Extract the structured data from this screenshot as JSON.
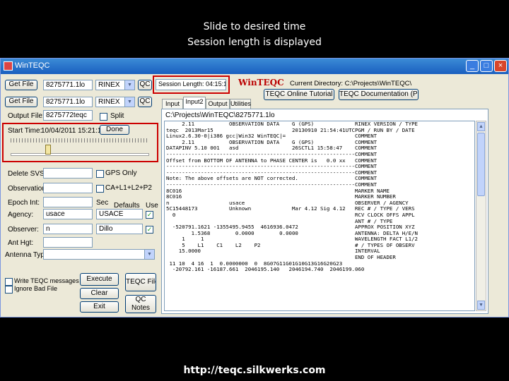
{
  "captions": {
    "line1": "Slide to desired time",
    "line2": "Session length is displayed",
    "url": "http://teqc.silkwerks.com"
  },
  "window": {
    "title": "WinTEQC",
    "controls": [
      "_",
      "□",
      "×"
    ]
  },
  "form": {
    "get_file_btn": "Get File",
    "get_file_path": "8275771.1lo",
    "get_file_combo": "RINEX",
    "qc_btn_1": "QC",
    "get_file2_btn": "Get File",
    "get_file2_path": "8275771.1lo",
    "get_file2_combo": "RINEX",
    "qc_btn_2": "QC",
    "output_file_label": "Output File:",
    "output_file_value": "8275772teqc",
    "split_label": "Split",
    "start_time_label": "Start Time:",
    "start_time_value": "10/04/2011 15:21:15",
    "done_btn": "Done",
    "delete_svs_label": "Delete SVS:",
    "gps_only_label": "GPS Only",
    "observations_label": "Observations:",
    "l1l2_label": "CA+L1+L2+P2",
    "epoch_int_label": "Epoch Int:",
    "sec_label": "Sec",
    "defaults_label": "Defaults",
    "use_label": "Use",
    "agency_label": "Agency:",
    "agency_value": "usace",
    "agency_default": "USACE",
    "observer_label": "Observer:",
    "observer_value": "n",
    "observer_default": "Dillo",
    "ant_hgt_label": "Ant Hgt:",
    "antenna_type_label": "Antenna Type",
    "write_teqc_label": "Write TEQC messages",
    "ignore_bad_label": "Ignore Bad File",
    "execute_btn": "Execute",
    "clear_btn": "Clear",
    "exit_btn": "Exit",
    "teqc_file_btn": "TEQC File",
    "qc_notes_btn": "QC Notes"
  },
  "header": {
    "session_length": "Session Length: 04:15:15",
    "logo": "WinTEQC",
    "current_dir": "Current Directory:  C:\\Projects\\WinTEQC\\",
    "online_tutorial_btn": "TEQC Online Tutorial",
    "documentation_btn": "TEQC Documentation (PDF)"
  },
  "tabs": [
    "Input",
    "Input2",
    "Output",
    "Utilities"
  ],
  "text_panel": {
    "path": "C:\\Projects\\WinTEQC\\8275771.1lo",
    "content": "     2.11           OBSERVATION DATA    G (GPS)             RINEX VERSION / TYPE\nteqc  2013Mar15                         20130910 21:54:41UTCPGM / RUN BY / DATE\nLinux2.6.30-0|i386 gcc|Win32 WinTEQC|=                      COMMENT\n     2.11           OBSERVATION DATA    G (GPS)             COMMENT\nDATAPINV 5.10 001   asd                 26SCTL1 15:58:47    COMMENT\n------------------------------------------------------------COMMENT\nOffset from BOTTOM OF ANTENNA to PHASE CENTER is   0.0 xx   COMMENT\n------------------------------------------------------------COMMENT\n------------------------------------------------------------COMMENT\nNote: The above offsets are NOT corrected.                  COMMENT\n------------------------------------------------------------COMMENT\n8C016                                                       MARKER NAME\n8C016                                                       MARKER NUMBER\nn                   usace                                   OBSERVER / AGENCY\n5C15448173          Unknown             Mar 4.12 Sig 4.12   REC # / TYPE / VERS\n  0                                                         RCV CLOCK OFFS APPL\n                                                            ANT # / TYPE\n  -520791.1621 -1355495.9455  4616936.0472                  APPROX POSITION XYZ\n        1.5368        0.0000        0.0000                  ANTENNA: DELTA H/E/N\n     1     1                                                WAVELENGTH FACT L1/2\n     5    L1    C1    L2    P2                              # / TYPES OF OBSERV\n    15.0000                                                 INTERVAL\n                                                            END OF HEADER\n 11 10  4 16  1  0.0000000  0  8G07G11G01G10G13G16G20G23\n  -20792.161 -16187.661  2046195.140   2046194.740  2046199.060"
  }
}
